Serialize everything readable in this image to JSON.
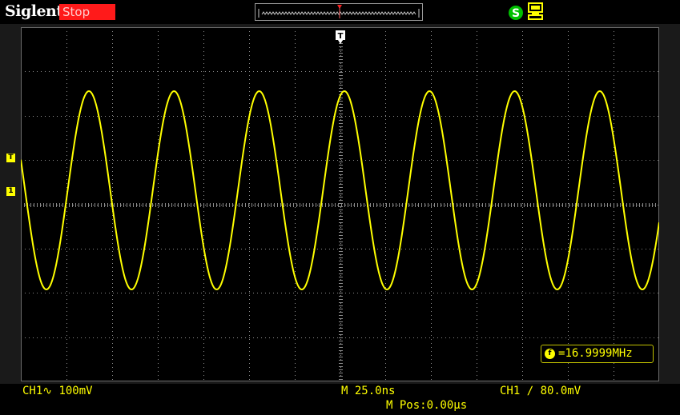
{
  "header": {
    "brand": "Siglent",
    "run_state": "Stop"
  },
  "markers": {
    "trigger_top": "T",
    "trigger_level": "T",
    "channel1": "1"
  },
  "waveform": {
    "channel": "CH1",
    "color": "#ffff00",
    "frequency_readout": "16.9999MHz",
    "frequency_prefix": "=",
    "frequency_icon": "f"
  },
  "footer": {
    "ch1_scale": "CH1∿ 100mV",
    "timebase": "M 25.0ns",
    "trigger_info": "CH1 ∕ 80.0mV",
    "position": "M Pos:0.00μs"
  },
  "icons": {
    "status_icon": "s-icon",
    "usb_icon": "usb-icon"
  },
  "colors": {
    "trace": "#ffff00",
    "stop_badge": "#ff1a1a",
    "grid": "#8a8a8a",
    "background": "#000000"
  }
}
